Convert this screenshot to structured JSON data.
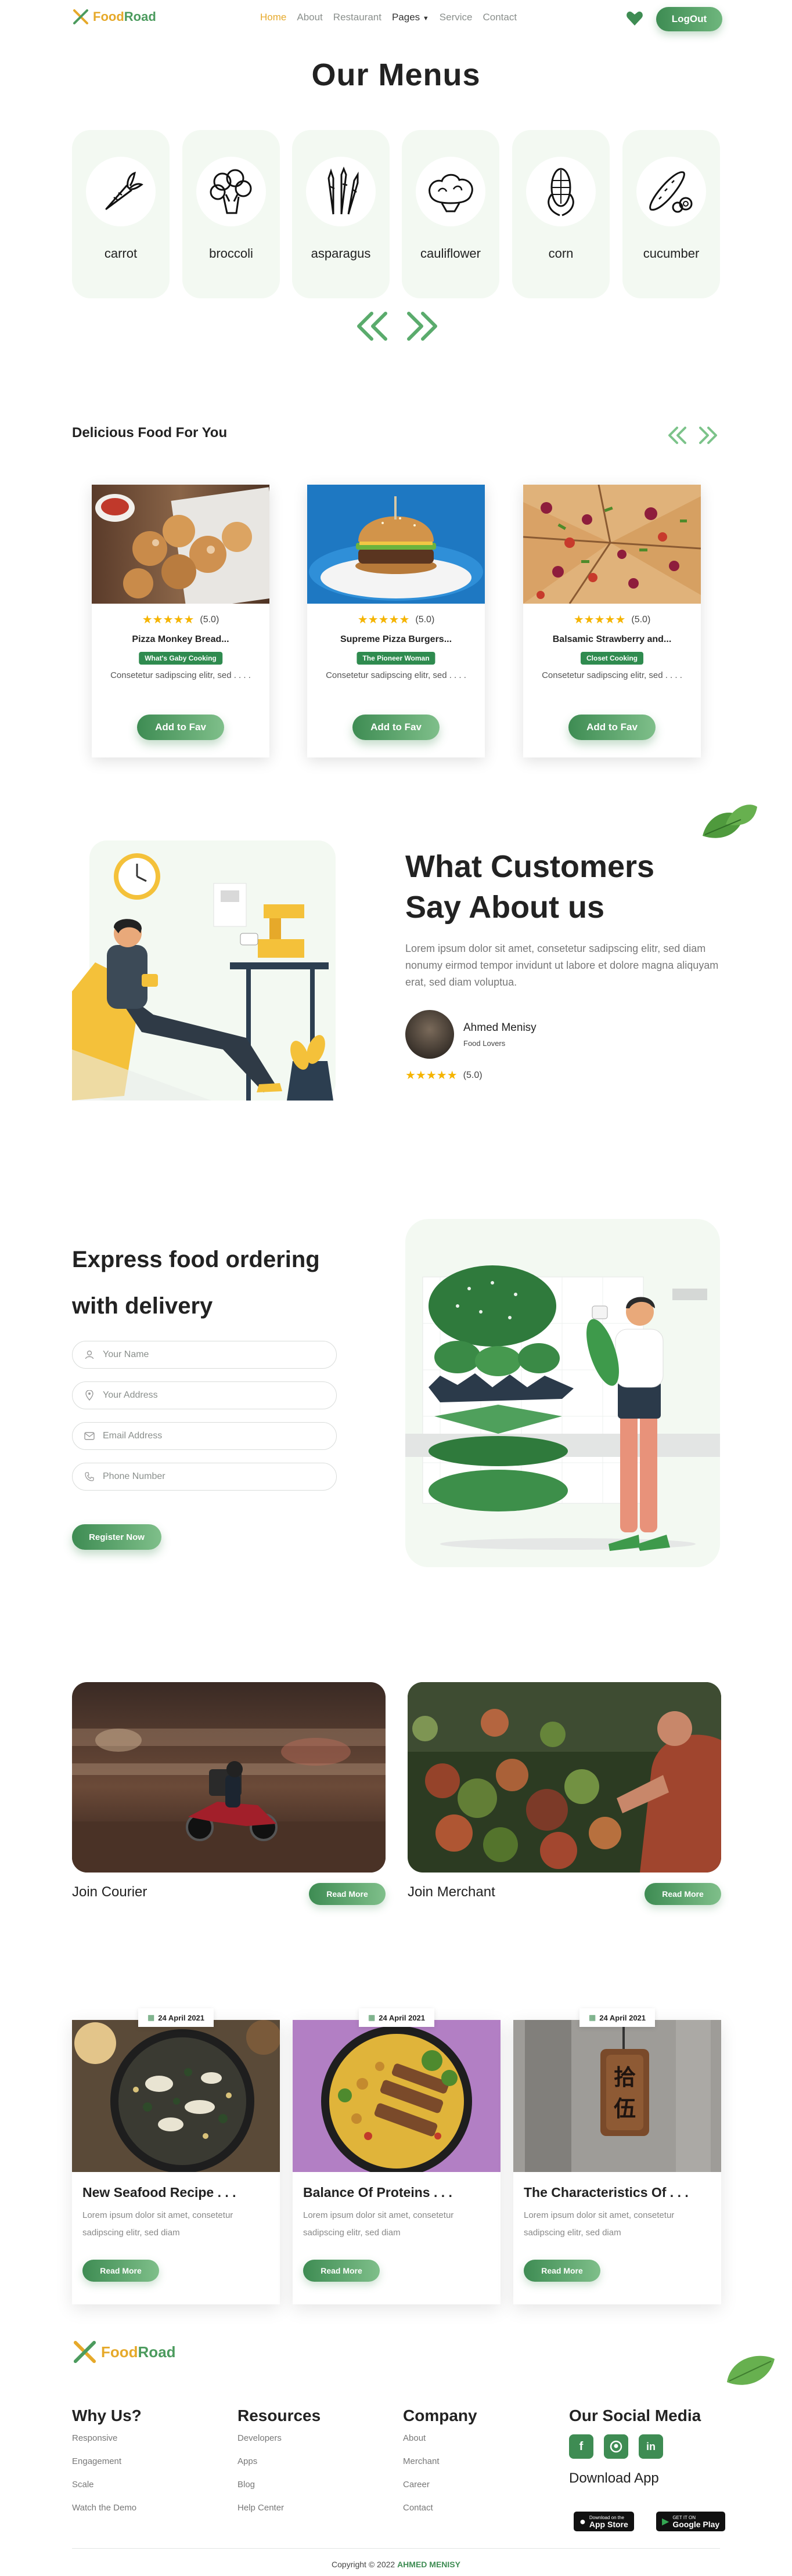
{
  "brand": {
    "name_part1": "Food",
    "name_part2": "Road"
  },
  "nav": {
    "links": [
      "Home",
      "About",
      "Restaurant",
      "Pages",
      "Service",
      "Contact"
    ],
    "logout_label": "LogOut"
  },
  "menus": {
    "title": "Our Menus",
    "items": [
      "carrot",
      "broccoli",
      "asparagus",
      "cauliflower",
      "corn",
      "cucumber"
    ]
  },
  "delicious": {
    "title": "Delicious Food For You",
    "cards": [
      {
        "name": "Pizza Monkey Bread...",
        "tag": "What's Gaby Cooking",
        "desc": "Consetetur sadipscing elitr, sed . . . .",
        "rating": "(5.0)",
        "button": "Add to Fav"
      },
      {
        "name": "Supreme Pizza Burgers...",
        "tag": "The Pioneer Woman",
        "desc": "Consetetur sadipscing elitr, sed . . . .",
        "rating": "(5.0)",
        "button": "Add to Fav"
      },
      {
        "name": "Balsamic Strawberry and...",
        "tag": "Closet Cooking",
        "desc": "Consetetur sadipscing elitr, sed . . . .",
        "rating": "(5.0)",
        "button": "Add to Fav"
      }
    ]
  },
  "testimonial": {
    "title_line1": "What Customers",
    "title_line2": "Say About us",
    "text": "Lorem ipsum dolor sit amet, consetetur sadipscing elitr, sed diam nonumy eirmod tempor invidunt ut labore et dolore magna aliquyam erat, sed diam voluptua.",
    "author": "Ahmed Menisy",
    "role": "Food Lovers",
    "rating": "(5.0)"
  },
  "express": {
    "title_line1": "Express food ordering",
    "title_line2": "with delivery",
    "fields": [
      "Your Name",
      "Your Address",
      "Email Address",
      "Phone Number"
    ],
    "button": "Register Now"
  },
  "join": {
    "courier_label": "Join Courier",
    "merchant_label": "Join Merchant",
    "button": "Read More"
  },
  "blog": {
    "cards": [
      {
        "date": "24 April 2021",
        "title": "New Seafood Recipe . . .",
        "desc": "Lorem ipsum dolor sit amet, consetetur sadipscing elitr, sed diam",
        "button": "Read More"
      },
      {
        "date": "24 April 2021",
        "title": "Balance Of Proteins . . .",
        "desc": "Lorem ipsum dolor sit amet, consetetur sadipscing elitr, sed diam",
        "button": "Read More"
      },
      {
        "date": "24 April 2021",
        "title": "The Characteristics Of . . .",
        "desc": "Lorem ipsum dolor sit amet, consetetur sadipscing elitr, sed diam",
        "button": "Read More"
      }
    ]
  },
  "footer": {
    "why_title": "Why Us?",
    "why_links": [
      "Responsive",
      "Engagement",
      "Scale",
      "Watch the Demo"
    ],
    "resources_title": "Resources",
    "resources_links": [
      "Developers",
      "Apps",
      "Blog",
      "Help Center"
    ],
    "company_title": "Company",
    "company_links": [
      "About",
      "Merchant",
      "Career",
      "Contact"
    ],
    "social_title": "Our Social Media",
    "download_title": "Download App",
    "appstore_small": "Download on the",
    "appstore_big": "App Store",
    "googleplay_small": "GET IT ON",
    "googleplay_big": "Google Play",
    "copyright_prefix": "Copyright © 2022",
    "copyright_name": "AHMED MENISY"
  },
  "colors": {
    "primary_green": "#3e8c53",
    "accent_yellow": "#e6a92a",
    "star": "#f5b400"
  }
}
